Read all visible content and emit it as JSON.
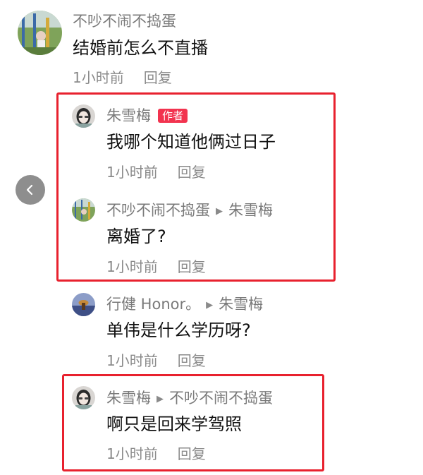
{
  "comment": {
    "username": "不吵不闹不捣蛋",
    "text": "结婚前怎么不直播",
    "time": "1小时前",
    "reply_label": "回复"
  },
  "replies": [
    {
      "username": "朱雪梅",
      "author_tag": "作者",
      "text": "我哪个知道他俩过日子",
      "time": "1小时前",
      "reply_label": "回复"
    },
    {
      "username": "不吵不闹不捣蛋",
      "reply_to": "朱雪梅",
      "text": "离婚了?",
      "time": "1小时前",
      "reply_label": "回复"
    },
    {
      "username": "行健 Honor。",
      "reply_to": "朱雪梅",
      "text": "单伟是什么学历呀?",
      "time": "1小时前",
      "reply_label": "回复"
    },
    {
      "username": "朱雪梅",
      "reply_to": "不吵不闹不捣蛋",
      "text": "啊只是回来学驾照",
      "time": "1小时前",
      "reply_label": "回复"
    }
  ],
  "colors": {
    "highlight_border": "#e8212e",
    "author_tag_bg": "#f2334f",
    "meta_text": "#8a8a8a"
  }
}
